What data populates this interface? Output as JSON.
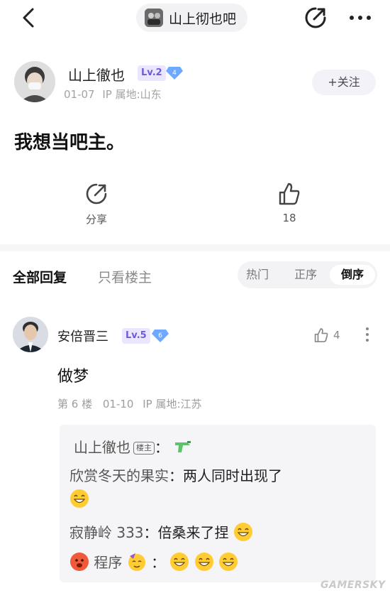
{
  "topbar": {
    "forum_name": "山上彻也吧",
    "back_icon": "chevron-left-icon",
    "share_icon": "share-icon",
    "more_icon": "more-icon"
  },
  "post": {
    "author": {
      "name": "山上徹也",
      "level": "Lv.2",
      "diamond_level": "4",
      "date": "01-07",
      "ip_location": "IP 属地:山东"
    },
    "follow_label": "+关注",
    "title": "我想当吧主。",
    "actions": {
      "share_label": "分享",
      "like_count": "18"
    }
  },
  "replies": {
    "tab_all": "全部回复",
    "tab_host_only": "只看楼主",
    "sort_options": [
      "热门",
      "正序",
      "倒序"
    ],
    "sort_active": "倒序"
  },
  "comment": {
    "name": "安倍晋三",
    "level": "Lv.5",
    "diamond_level": "6",
    "like_count": "4",
    "text": "做梦",
    "floor": "第 6 楼",
    "date": "01-10",
    "ip_location": "IP 属地:江苏",
    "sub_replies": {
      "r1_name": "山上徹也",
      "r1_tag": "楼主",
      "r2_name": "欣赏冬天的果实",
      "r2_text": "两人同时出现了",
      "r3_name": "寂静岭 333",
      "r3_text": "倍桑来了捏",
      "r4_name": "程序"
    }
  },
  "watermark": "GAMERSKY",
  "colors": {
    "level_badge_bg": "#eae6ff",
    "level_badge_text": "#6f5bd7",
    "diamond": "#6ea8ff",
    "sub_reply_bg": "#f5f5f7"
  }
}
